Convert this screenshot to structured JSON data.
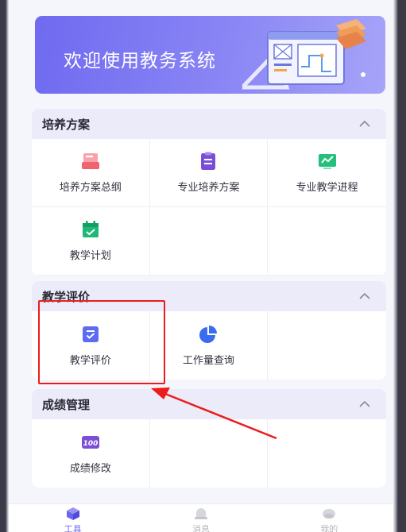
{
  "banner": {
    "title": "欢迎使用教务系统"
  },
  "sections": [
    {
      "title": "培养方案",
      "items": [
        {
          "label": "培养方案总纲",
          "icon": "red-tray-icon",
          "color": "#f0646e"
        },
        {
          "label": "专业培养方案",
          "icon": "purple-clipboard-icon",
          "color": "#7a4fd6"
        },
        {
          "label": "专业教学进程",
          "icon": "green-chart-icon",
          "color": "#22c07a"
        },
        {
          "label": "教学计划",
          "icon": "green-calendar-icon",
          "color": "#1fb877"
        }
      ]
    },
    {
      "title": "教学评价",
      "items": [
        {
          "label": "教学评价",
          "icon": "blue-evaluation-icon",
          "color": "#5b6cf0"
        },
        {
          "label": "工作量查询",
          "icon": "blue-pie-chart-icon",
          "color": "#3a6cf0"
        }
      ]
    },
    {
      "title": "成绩管理",
      "items": [
        {
          "label": "成绩修改",
          "icon": "purple-100-score-icon",
          "color": "#7a4fd6"
        }
      ]
    }
  ],
  "score_icon_text": "100",
  "tabbar": [
    {
      "label": "工具",
      "icon": "cube-icon",
      "active": true
    },
    {
      "label": "消息",
      "icon": "bell-icon",
      "active": false
    },
    {
      "label": "我的",
      "icon": "user-icon",
      "active": false
    }
  ],
  "colors": {
    "accent": "#6c63f0",
    "highlight": "#ec1c1c"
  }
}
